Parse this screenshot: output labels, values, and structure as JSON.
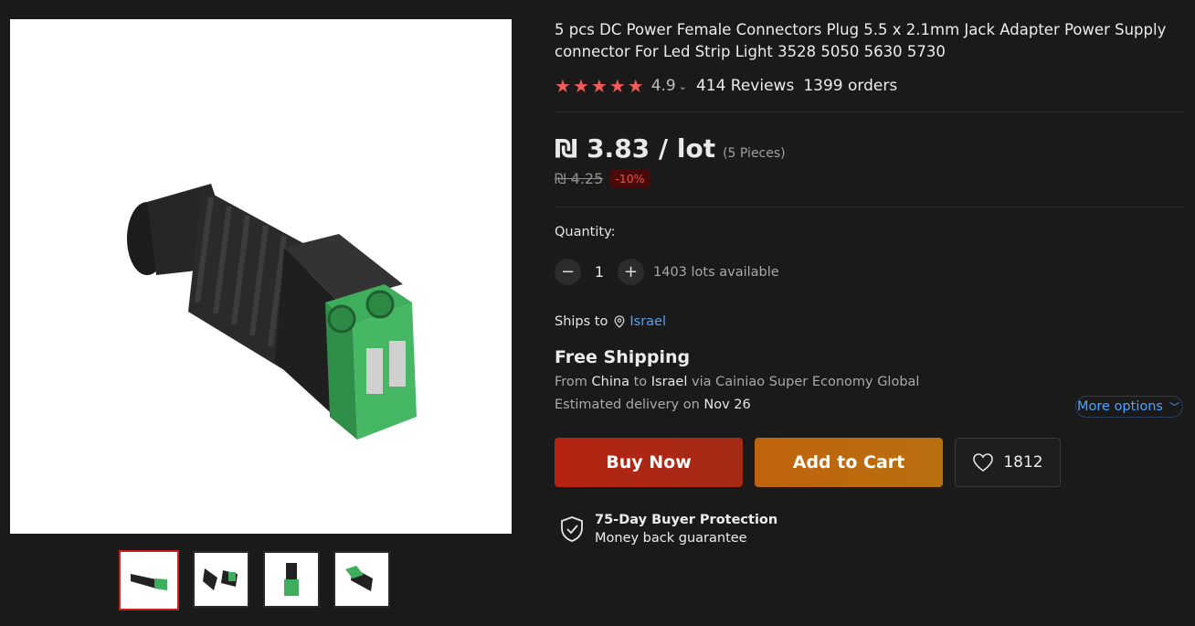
{
  "product": {
    "title": "5 pcs DC Power Female Connectors Plug 5.5 x 2.1mm Jack Adapter Power Supply connector For Led Strip Light 3528 5050 5630 5730",
    "rating": "4.9",
    "rating_stars": 5,
    "reviews": "414 Reviews",
    "orders": "1399 orders"
  },
  "price": {
    "current": "₪ 3.83 / lot",
    "note": "(5 Pieces)",
    "original": "₪ 4.25",
    "discount": "-10%"
  },
  "quantity": {
    "label": "Quantity:",
    "value": "1",
    "available": "1403 lots available"
  },
  "shipping": {
    "ships_to_label": "Ships to",
    "country": "Israel",
    "title": "Free Shipping",
    "from_prefix": "From ",
    "from_country": "China",
    "to_word": " to ",
    "to_country": "Israel",
    "carrier": " via Cainiao Super Economy Global",
    "eta_prefix": "Estimated delivery on ",
    "eta_date": "Nov 26",
    "more_options": "More options"
  },
  "actions": {
    "buy_now": "Buy Now",
    "add_to_cart": "Add to Cart",
    "wishlist_count": "1812"
  },
  "protection": {
    "title": "75-Day Buyer Protection",
    "subtitle": "Money back guarantee"
  },
  "icons": {
    "star": "star-icon",
    "minus": "minus-icon",
    "plus": "plus-icon",
    "pin": "location-pin-icon",
    "heart": "heart-icon",
    "shield": "shield-check-icon"
  },
  "colors": {
    "star": "#f35a5a",
    "buy": "#b52412",
    "cart": "#c0630d",
    "link": "#4aa3ff",
    "discount": "#ff4a4a"
  }
}
